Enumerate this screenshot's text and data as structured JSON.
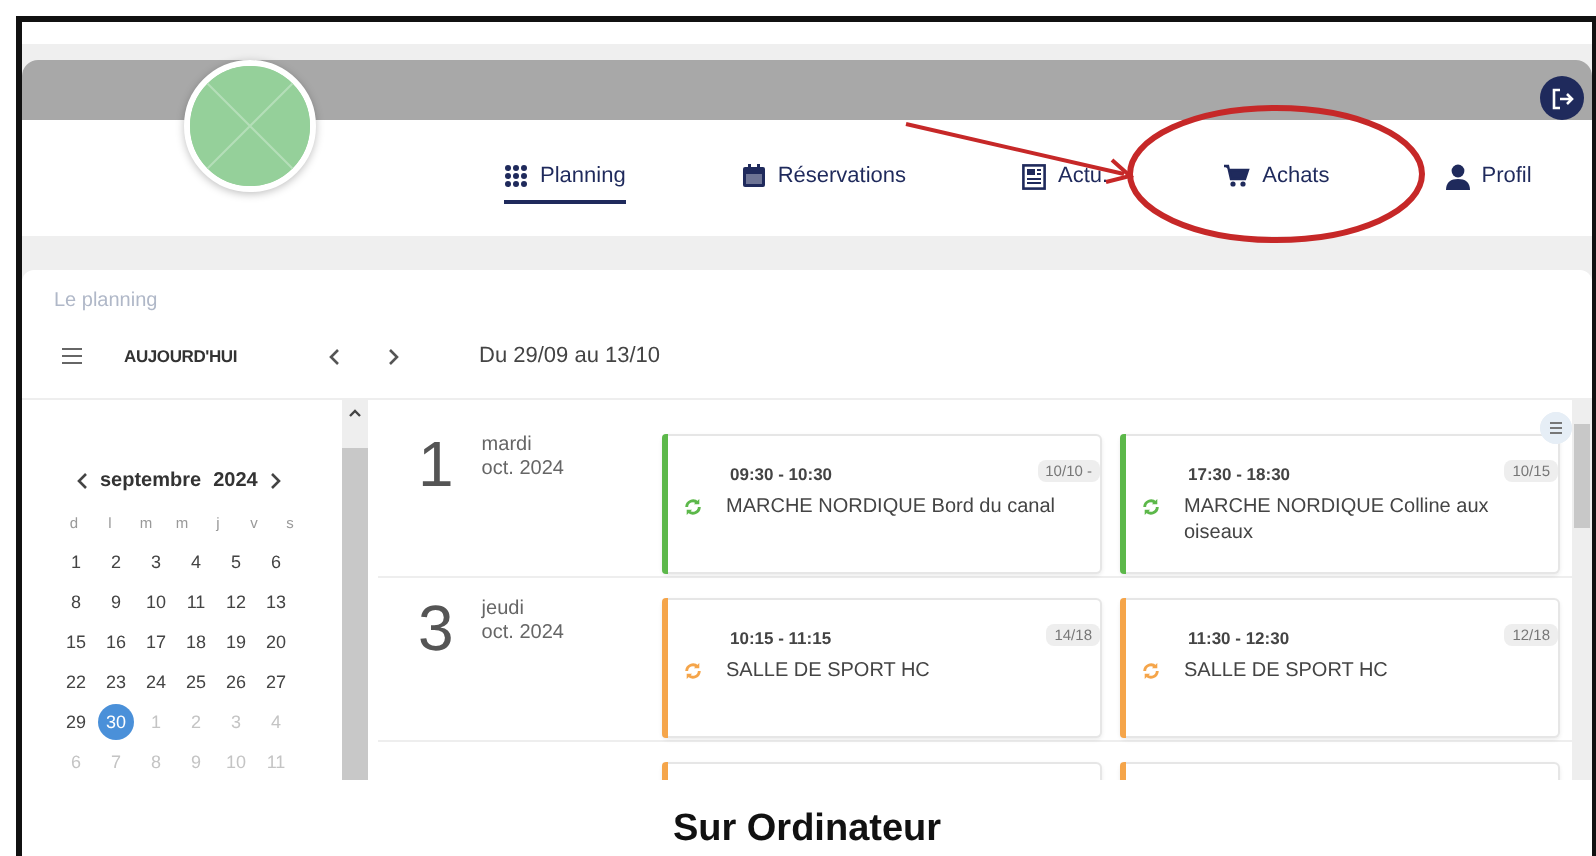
{
  "header": {
    "nav": [
      {
        "label": "Planning",
        "selected": true
      },
      {
        "label": "Réservations",
        "selected": false
      },
      {
        "label": "Actu.",
        "selected": false
      },
      {
        "label": "Achats",
        "selected": false
      },
      {
        "label": "Profil",
        "selected": false
      }
    ]
  },
  "page_title": "Le planning",
  "toolbar": {
    "today": "AUJOURD'HUI",
    "range": "Du 29/09 au 13/10"
  },
  "calendar": {
    "month": "septembre",
    "year": "2024",
    "weekdays": [
      "d",
      "l",
      "m",
      "m",
      "j",
      "v",
      "s"
    ],
    "weeks": [
      [
        {
          "day": "1",
          "muted": false,
          "selected": false
        },
        {
          "day": "2",
          "muted": false,
          "selected": false
        },
        {
          "day": "3",
          "muted": false,
          "selected": false
        },
        {
          "day": "4",
          "muted": false,
          "selected": false
        },
        {
          "day": "5",
          "muted": false,
          "selected": false
        },
        {
          "day": "6",
          "muted": false,
          "selected": false
        }
      ],
      [
        {
          "day": "8",
          "muted": false,
          "selected": false
        },
        {
          "day": "9",
          "muted": false,
          "selected": false
        },
        {
          "day": "10",
          "muted": false,
          "selected": false
        },
        {
          "day": "11",
          "muted": false,
          "selected": false
        },
        {
          "day": "12",
          "muted": false,
          "selected": false
        },
        {
          "day": "13",
          "muted": false,
          "selected": false
        }
      ],
      [
        {
          "day": "15",
          "muted": false,
          "selected": false
        },
        {
          "day": "16",
          "muted": false,
          "selected": false
        },
        {
          "day": "17",
          "muted": false,
          "selected": false
        },
        {
          "day": "18",
          "muted": false,
          "selected": false
        },
        {
          "day": "19",
          "muted": false,
          "selected": false
        },
        {
          "day": "20",
          "muted": false,
          "selected": false
        }
      ],
      [
        {
          "day": "22",
          "muted": false,
          "selected": false
        },
        {
          "day": "23",
          "muted": false,
          "selected": false
        },
        {
          "day": "24",
          "muted": false,
          "selected": false
        },
        {
          "day": "25",
          "muted": false,
          "selected": false
        },
        {
          "day": "26",
          "muted": false,
          "selected": false
        },
        {
          "day": "27",
          "muted": false,
          "selected": false
        }
      ],
      [
        {
          "day": "29",
          "muted": false,
          "selected": false
        },
        {
          "day": "30",
          "muted": false,
          "selected": true
        },
        {
          "day": "1",
          "muted": true,
          "selected": false
        },
        {
          "day": "2",
          "muted": true,
          "selected": false
        },
        {
          "day": "3",
          "muted": true,
          "selected": false
        },
        {
          "day": "4",
          "muted": true,
          "selected": false
        }
      ],
      [
        {
          "day": "6",
          "muted": true,
          "selected": false
        },
        {
          "day": "7",
          "muted": true,
          "selected": false
        },
        {
          "day": "8",
          "muted": true,
          "selected": false
        },
        {
          "day": "9",
          "muted": true,
          "selected": false
        },
        {
          "day": "10",
          "muted": true,
          "selected": false
        },
        {
          "day": "11",
          "muted": true,
          "selected": false
        }
      ]
    ]
  },
  "days": [
    {
      "number": "1",
      "weekday": "mardi",
      "month": "oct. 2024",
      "events": [
        {
          "time": "09:30 - 10:30",
          "title": "MARCHE NORDIQUE Bord du canal",
          "badge": "10/10 -",
          "color": "#5cb84a"
        },
        {
          "time": "17:30 - 18:30",
          "title": "MARCHE NORDIQUE Colline aux oiseaux",
          "badge": "10/15",
          "color": "#5cb84a"
        }
      ]
    },
    {
      "number": "3",
      "weekday": "jeudi",
      "month": "oct. 2024",
      "events": [
        {
          "time": "10:15 - 11:15",
          "title": "SALLE DE SPORT HC",
          "badge": "14/18",
          "color": "#f5a54a"
        },
        {
          "time": "11:30 - 12:30",
          "title": "SALLE DE SPORT HC",
          "badge": "12/18",
          "color": "#f5a54a"
        }
      ]
    },
    {
      "events": [
        {
          "color": "#f5a54a"
        },
        {
          "color": "#f5a54a"
        }
      ]
    }
  ],
  "caption": "Sur Ordinateur"
}
